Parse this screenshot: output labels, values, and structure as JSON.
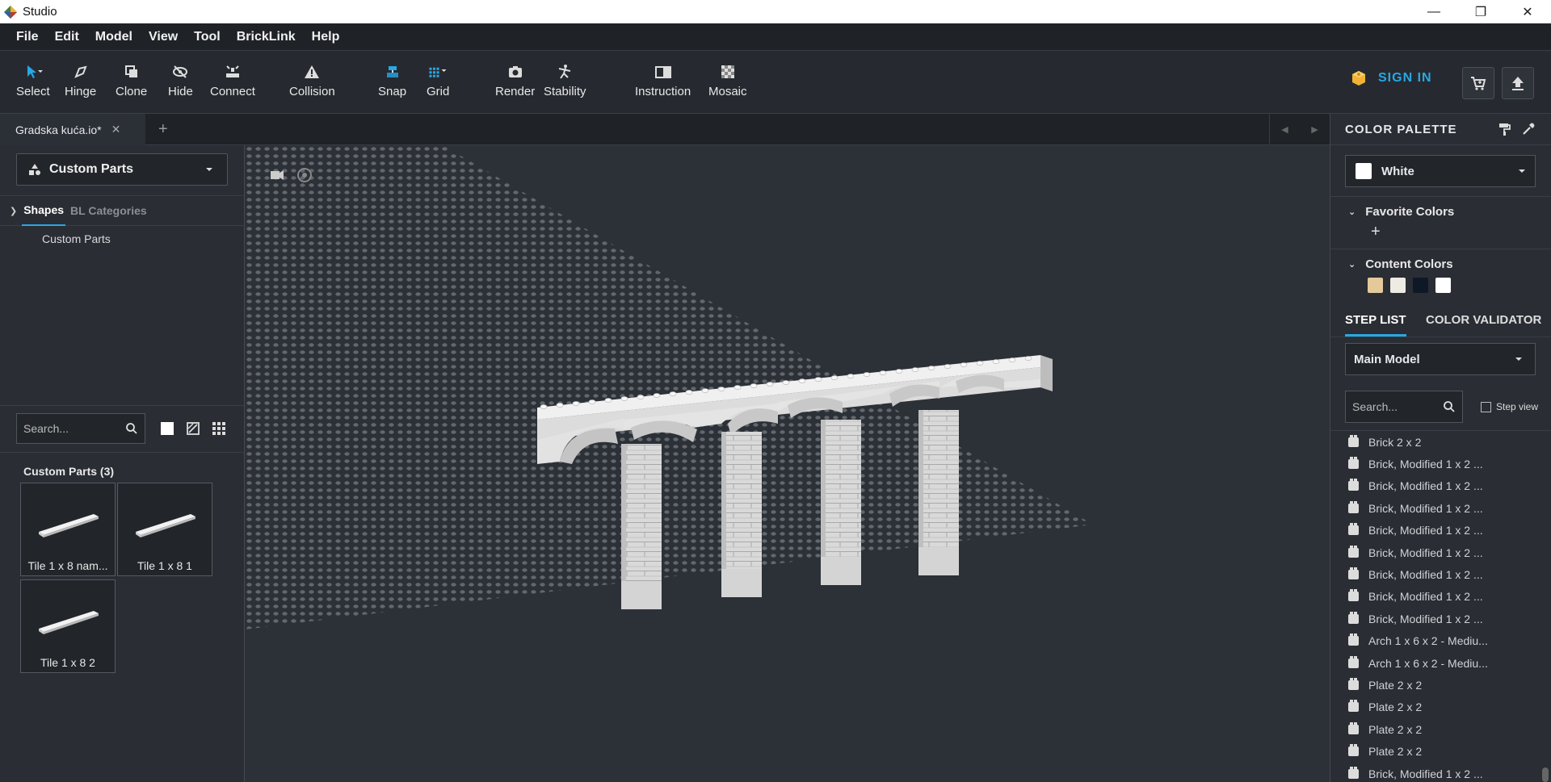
{
  "window": {
    "title": "Studio"
  },
  "menu": [
    "File",
    "Edit",
    "Model",
    "View",
    "Tool",
    "BrickLink",
    "Help"
  ],
  "toolbar": {
    "select": "Select",
    "hinge": "Hinge",
    "clone": "Clone",
    "hide": "Hide",
    "connect": "Connect",
    "collision": "Collision",
    "snap": "Snap",
    "grid": "Grid",
    "render": "Render",
    "stability": "Stability",
    "instruction": "Instruction",
    "mosaic": "Mosaic",
    "signin": "SIGN IN"
  },
  "tabs": {
    "file": "Gradska kuća.io*"
  },
  "left": {
    "source": "Custom Parts",
    "tab_shapes": "Shapes",
    "tab_bl": "BL Categories",
    "tree_item": "Custom Parts",
    "search_placeholder": "Search...",
    "parts_title": "Custom Parts (3)",
    "parts": [
      "Tile 1 x 8 nam...",
      "Tile 1 x 8 1",
      "Tile 1 x 8 2"
    ]
  },
  "right": {
    "palette_title": "COLOR PALETTE",
    "selected_color": "White",
    "favorite": "Favorite Colors",
    "content": "Content Colors",
    "content_swatches": [
      "#e4c99a",
      "#eeebe4",
      "#0f1826",
      "#ffffff"
    ],
    "step_list": "STEP LIST",
    "color_validator": "COLOR VALIDATOR",
    "model": "Main Model",
    "search_placeholder": "Search...",
    "step_view": "Step view",
    "items": [
      "Brick 2 x 2",
      "Brick, Modified 1 x 2 ...",
      "Brick, Modified 1 x 2 ...",
      "Brick, Modified 1 x 2 ...",
      "Brick, Modified 1 x 2 ...",
      "Brick, Modified 1 x 2 ...",
      "Brick, Modified 1 x 2 ...",
      "Brick, Modified 1 x 2 ...",
      "Brick, Modified 1 x 2 ...",
      "Arch 1 x 6 x 2 - Mediu...",
      "Arch 1 x 6 x 2 - Mediu...",
      "Plate 2 x 2",
      "Plate 2 x 2",
      "Plate 2 x 2",
      "Plate 2 x 2",
      "Brick, Modified 1 x 2 ..."
    ]
  },
  "colors": {
    "accent": "#27a8e6",
    "signin_icon": "#f2b233"
  }
}
